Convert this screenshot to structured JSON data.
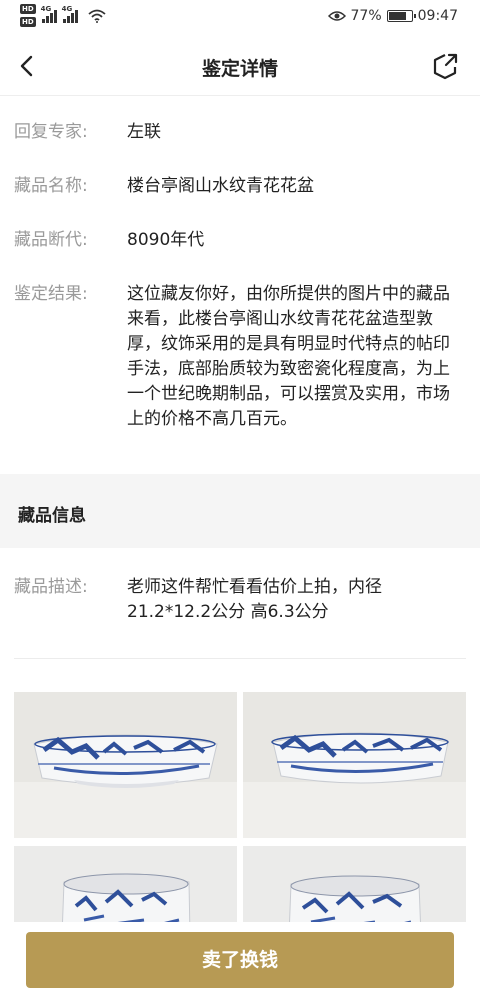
{
  "status_bar": {
    "hd_badge": "HD",
    "network": "4G",
    "battery": "77%",
    "battery_level": 0.77,
    "time": "09:47"
  },
  "header": {
    "title": "鉴定详情",
    "back_icon": "chevron-left-icon",
    "share_icon": "share-icon"
  },
  "details": {
    "expert_label": "回复专家:",
    "expert_value": "左联",
    "name_label": "藏品名称:",
    "name_value": "楼台亭阁山水纹青花花盆",
    "era_label": "藏品断代:",
    "era_value": "8090年代",
    "result_label": "鉴定结果:",
    "result_value": "这位藏友你好，由你所提供的图片中的藏品来看，此楼台亭阁山水纹青花花盆造型敦厚，纹饰采用的是具有明显时代特点的帖印手法，底部胎质较为致密瓷化程度高，为上一个世纪晚期制品，可以摆赏及实用，市场上的价格不高几百元。"
  },
  "collection_info": {
    "section_title": "藏品信息",
    "description_label": "藏品描述:",
    "description_value": "老师这件帮忙看看估价上拍，内径21.2*12.2公分 高6.3公分"
  },
  "photos": [
    "blue-white-porcelain-planter-side",
    "blue-white-porcelain-planter-side",
    "blue-white-porcelain-planter-front",
    "blue-white-porcelain-planter-front"
  ],
  "actions": {
    "sell_label": "卖了换钱"
  },
  "colors": {
    "accent_gold": "#b79a54",
    "label_gray": "#9a9a9a",
    "section_bg": "#f5f5f5",
    "porcelain_blue": "#2e4f9a"
  }
}
